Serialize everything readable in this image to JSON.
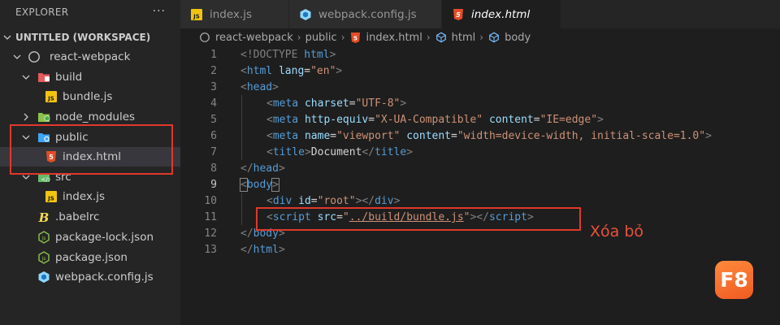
{
  "sidebar": {
    "header": "EXPLORER",
    "more": "···",
    "workspace": "UNTITLED (WORKSPACE)",
    "items": [
      {
        "label": "react-webpack",
        "icon": "project-root-icon"
      },
      {
        "label": "build",
        "icon": "folder-build-icon"
      },
      {
        "label": "bundle.js",
        "icon": "js-file-icon"
      },
      {
        "label": "node_modules",
        "icon": "folder-node-icon"
      },
      {
        "label": "public",
        "icon": "folder-public-icon"
      },
      {
        "label": "index.html",
        "icon": "html5-file-icon"
      },
      {
        "label": "src",
        "icon": "folder-src-icon"
      },
      {
        "label": "index.js",
        "icon": "js-file-icon"
      },
      {
        "label": ".babelrc",
        "icon": "babel-file-icon"
      },
      {
        "label": "package-lock.json",
        "icon": "node-json-file-icon"
      },
      {
        "label": "package.json",
        "icon": "node-json-file-icon"
      },
      {
        "label": "webpack.config.js",
        "icon": "webpack-file-icon"
      }
    ]
  },
  "tabs": [
    {
      "label": "index.js",
      "icon": "js-file-icon"
    },
    {
      "label": "webpack.config.js",
      "icon": "webpack-file-icon"
    },
    {
      "label": "index.html",
      "icon": "html5-file-icon",
      "active": true
    }
  ],
  "breadcrumb": [
    "react-webpack",
    "public",
    "index.html",
    "html",
    "body"
  ],
  "editor": {
    "line_numbers": [
      "1",
      "2",
      "3",
      "4",
      "5",
      "6",
      "7",
      "8",
      "9",
      "10",
      "11",
      "12",
      "13"
    ],
    "lines": {
      "l1_a": "<!DOCTYPE",
      "l1_b": " html",
      "l1_c": ">",
      "l2_a": "<",
      "l2_b": "html",
      "l2_c": " lang",
      "l2_d": "=",
      "l2_e": "\"en\"",
      "l2_f": ">",
      "l3_a": "<",
      "l3_b": "head",
      "l3_c": ">",
      "l4_a": "<",
      "l4_b": "meta",
      "l4_c": " charset",
      "l4_d": "=",
      "l4_e": "\"UTF-8\"",
      "l4_f": ">",
      "l5_a": "<",
      "l5_b": "meta",
      "l5_c": " http-equiv",
      "l5_d": "=",
      "l5_e": "\"X-UA-Compatible\"",
      "l5_f": " content",
      "l5_g": "=",
      "l5_h": "\"IE=edge\"",
      "l5_i": ">",
      "l6_a": "<",
      "l6_b": "meta",
      "l6_c": " name",
      "l6_d": "=",
      "l6_e": "\"viewport\"",
      "l6_f": " content",
      "l6_g": "=",
      "l6_h": "\"width=device-width, initial-scale=1.0\"",
      "l6_i": ">",
      "l7_a": "<",
      "l7_b": "title",
      "l7_c": ">",
      "l7_d": "Document",
      "l7_e": "</",
      "l7_f": "title",
      "l7_g": ">",
      "l8_a": "</",
      "l8_b": "head",
      "l8_c": ">",
      "l9_a": "<",
      "l9_b": "body",
      "l9_c": ">",
      "l10_a": "<",
      "l10_b": "div",
      "l10_c": " id",
      "l10_d": "=",
      "l10_e": "\"root\"",
      "l10_f": "></",
      "l10_g": "div",
      "l10_h": ">",
      "l11_a": "<",
      "l11_b": "script",
      "l11_c": " src",
      "l11_d": "=",
      "l11_e": "\"",
      "l11_f": "../build/bundle.js",
      "l11_g": "\"",
      "l11_h": "></",
      "l11_i": "script",
      "l11_j": ">",
      "l12_a": "</",
      "l12_b": "body",
      "l12_c": ">",
      "l13_a": "</",
      "l13_b": "html",
      "l13_c": ">"
    }
  },
  "annotation_note": "Xóa bỏ",
  "logo_text": "F8",
  "colors": {
    "annotation": "#e0392b",
    "logo": "#f26b2a",
    "tag": "#569cd6",
    "attribute": "#9cdcfe",
    "string": "#ce9178"
  }
}
